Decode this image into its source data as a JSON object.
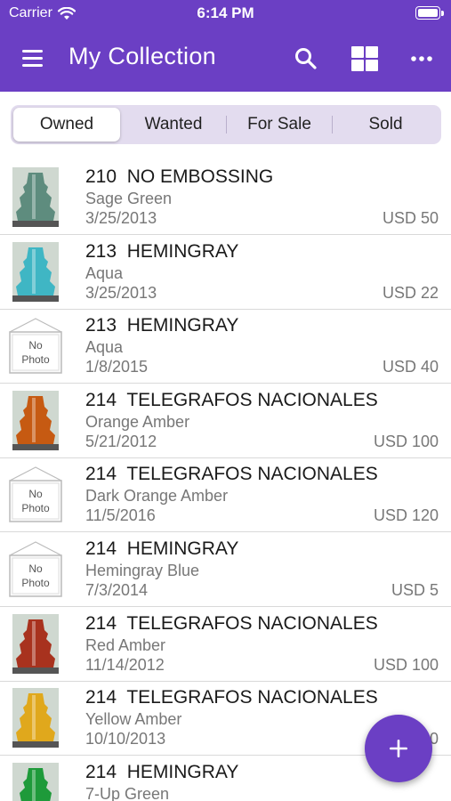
{
  "status_bar": {
    "carrier": "Carrier",
    "time": "6:14 PM"
  },
  "app_bar": {
    "title": "My Collection"
  },
  "tabs": [
    {
      "label": "Owned",
      "selected": true
    },
    {
      "label": "Wanted",
      "selected": false
    },
    {
      "label": "For Sale",
      "selected": false
    },
    {
      "label": "Sold",
      "selected": false
    }
  ],
  "no_photo_label": {
    "line1": "No",
    "line2": "Photo"
  },
  "items": [
    {
      "title": "210  NO EMBOSSING",
      "color": "Sage Green",
      "date": "3/25/2013",
      "price": "USD 50",
      "photo": "glass-insulator",
      "tint": "#5E8C7E"
    },
    {
      "title": "213  HEMINGRAY",
      "color": "Aqua",
      "date": "3/25/2013",
      "price": "USD 22",
      "photo": "glass-insulator",
      "tint": "#3FB6C4"
    },
    {
      "title": "213  HEMINGRAY",
      "color": "Aqua",
      "date": "1/8/2015",
      "price": "USD 40",
      "photo": "no-photo"
    },
    {
      "title": "214  TELEGRAFOS NACIONALES",
      "color": "Orange Amber",
      "date": "5/21/2012",
      "price": "USD 100",
      "photo": "glass-insulator",
      "tint": "#C65A12"
    },
    {
      "title": "214  TELEGRAFOS NACIONALES",
      "color": "Dark Orange Amber",
      "date": "11/5/2016",
      "price": "USD 120",
      "photo": "no-photo"
    },
    {
      "title": "214  HEMINGRAY",
      "color": "Hemingray Blue",
      "date": "7/3/2014",
      "price": "USD 5",
      "photo": "no-photo"
    },
    {
      "title": "214  TELEGRAFOS NACIONALES",
      "color": "Red Amber",
      "date": "11/14/2012",
      "price": "USD 100",
      "photo": "glass-insulator",
      "tint": "#A8321E"
    },
    {
      "title": "214  TELEGRAFOS NACIONALES",
      "color": "Yellow Amber",
      "date": "10/10/2013",
      "price": "USD 100",
      "photo": "glass-insulator",
      "tint": "#E0A81C"
    },
    {
      "title": "214  HEMINGRAY",
      "color": "7-Up Green",
      "date": "",
      "price": "",
      "photo": "glass-insulator",
      "tint": "#1E9A3A"
    }
  ],
  "icons": {
    "menu": "menu-icon",
    "search": "search-icon",
    "grid": "grid-view-icon",
    "more": "more-icon",
    "add": "plus-icon"
  },
  "colors": {
    "primary": "#6B3FC4",
    "segment_bg": "#E3DCEF",
    "secondary_text": "#777777"
  }
}
